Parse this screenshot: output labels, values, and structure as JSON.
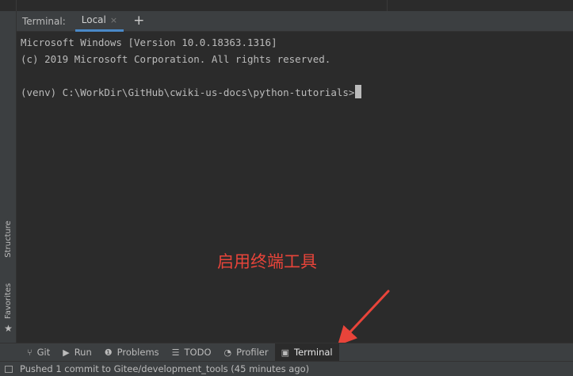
{
  "terminal": {
    "title": "Terminal:",
    "tab_label": "Local",
    "close_glyph": "×",
    "add_glyph": "+",
    "lines": [
      "Microsoft Windows [Version 10.0.18363.1316]",
      "(c) 2019 Microsoft Corporation. All rights reserved.",
      "",
      "(venv) C:\\WorkDir\\GitHub\\cwiki-us-docs\\python-tutorials>"
    ]
  },
  "left_strip": {
    "structure_label": "Structure",
    "favorites_label": "Favorites",
    "favorites_glyph": "★"
  },
  "annotation": {
    "text": "启用终端工具",
    "color": "#e8443a"
  },
  "tool_bar": {
    "tabs": [
      {
        "label": "Git",
        "icon": "git-branch-icon",
        "glyph": "⑂"
      },
      {
        "label": "Run",
        "icon": "run-icon",
        "glyph": "▶"
      },
      {
        "label": "Problems",
        "icon": "problems-icon",
        "glyph": "❶"
      },
      {
        "label": "TODO",
        "icon": "todo-icon",
        "glyph": "☰"
      },
      {
        "label": "Profiler",
        "icon": "profiler-icon",
        "glyph": "◔"
      },
      {
        "label": "Terminal",
        "icon": "terminal-icon",
        "glyph": "▣"
      }
    ],
    "active": "Terminal"
  },
  "status_bar": {
    "message": "Pushed 1 commit to Gitee/development_tools (45 minutes ago)"
  },
  "colors": {
    "background": "#2b2b2b",
    "panel": "#3c3f41",
    "accent_tab": "#4a88c7",
    "annotation": "#e8443a"
  }
}
